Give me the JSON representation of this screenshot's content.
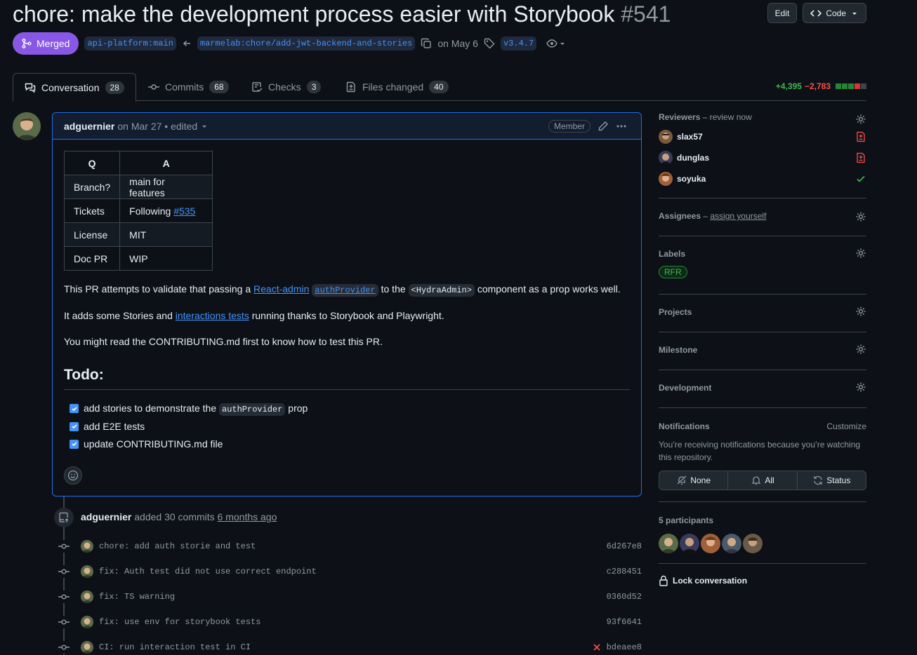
{
  "pr": {
    "title": "chore: make the development process easier with Storybook",
    "number": "#541"
  },
  "header": {
    "edit_label": "Edit",
    "code_label": "Code"
  },
  "meta": {
    "state": "Merged",
    "base_branch": "api-platform:main",
    "head_branch": "marmelab:chore/add-jwt-backend-and-stories",
    "date": "on May 6",
    "tag": "v3.4.7"
  },
  "tabs": [
    {
      "label": "Conversation",
      "count": "28",
      "icon": "comment-discussion-icon"
    },
    {
      "label": "Commits",
      "count": "68",
      "icon": "git-commit-icon"
    },
    {
      "label": "Checks",
      "count": "3",
      "icon": "checklist-icon"
    },
    {
      "label": "Files changed",
      "count": "40",
      "icon": "file-diff-icon"
    }
  ],
  "diffstat": {
    "additions": "+4,395",
    "deletions": "−2,783"
  },
  "comment": {
    "author": "adguernier",
    "meta": "on Mar 27 • edited",
    "role": "Member",
    "table": {
      "headers": [
        "Q",
        "A"
      ],
      "rows": [
        [
          "Branch?",
          "main for features"
        ],
        [
          "Tickets",
          "Following ",
          "#535"
        ],
        [
          "License",
          "MIT"
        ],
        [
          "Doc PR",
          "WIP"
        ]
      ]
    },
    "p1": {
      "a": "This PR attempts to validate that passing a ",
      "link": "React-admin",
      "code": "authProvider",
      "b": " to the ",
      "code2": "<HydraAdmin>",
      "c": " component as a prop works well."
    },
    "p2": {
      "a": "It adds some Stories and ",
      "link": "interactions tests",
      "b": " running thanks to Storybook and Playwright."
    },
    "p3": "You might read the CONTRIBUTING.md first to know how to test this PR.",
    "todo_heading": "Todo:",
    "tasks": [
      {
        "a": "add stories to demonstrate the ",
        "code": "authProvider",
        "b": " prop",
        "checked": true
      },
      {
        "a": "add E2E tests",
        "checked": true
      },
      {
        "a": "update CONTRIBUTING.md file",
        "checked": true
      }
    ]
  },
  "timeline": {
    "author": "adguernier",
    "text": "added 30 commits",
    "time": "6 months ago",
    "commits": [
      {
        "message": "chore: add auth storie and test",
        "sha": "6d267e8",
        "failed": false
      },
      {
        "message": "fix: Auth test did not use correct endpoint",
        "sha": "c288451",
        "failed": false
      },
      {
        "message": "fix: TS warning",
        "sha": "0360d52",
        "failed": false
      },
      {
        "message": "fix: use env for storybook tests",
        "sha": "93f6641",
        "failed": false
      },
      {
        "message": "CI: run interaction test in CI",
        "sha": "bdeaee8",
        "failed": true
      }
    ]
  },
  "sidebar": {
    "reviewers": {
      "title": "Reviewers",
      "hint": " – review now",
      "list": [
        {
          "name": "slax57",
          "status": "changes-requested-icon"
        },
        {
          "name": "dunglas",
          "status": "changes-requested-icon"
        },
        {
          "name": "soyuka",
          "status": "approved-check-icon"
        }
      ]
    },
    "assignees": {
      "title": "Assignees",
      "sep": " – ",
      "hint": "assign yourself"
    },
    "labels": {
      "title": "Labels",
      "items": [
        "RFR"
      ]
    },
    "projects": {
      "title": "Projects"
    },
    "milestone": {
      "title": "Milestone"
    },
    "development": {
      "title": "Development"
    },
    "notifications": {
      "title": "Notifications",
      "customize": "Customize",
      "text": "You’re receiving notifications because you’re watching this repository.",
      "options": [
        "None",
        "All",
        "Status"
      ]
    },
    "participants": {
      "title": "5 participants"
    },
    "lock": "Lock conversation"
  },
  "colors": {
    "merged": "#8957e5",
    "accent": "#4493f8",
    "success": "#3fb950",
    "danger": "#f85149",
    "bg": "#0d1117"
  }
}
